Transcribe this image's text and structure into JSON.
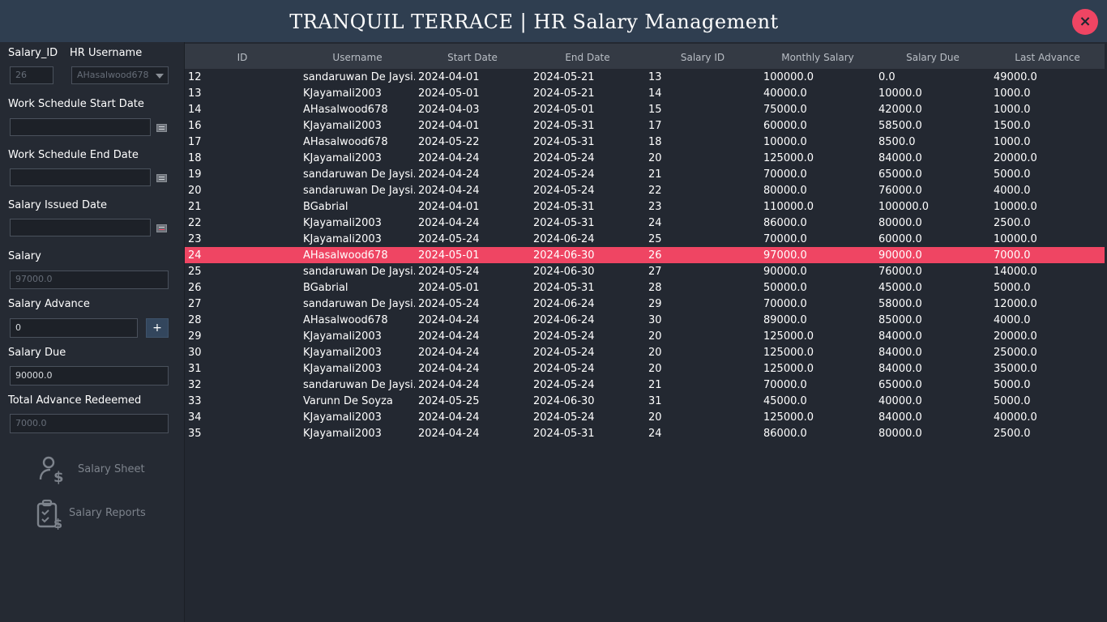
{
  "app": {
    "title": "TRANQUIL TERRACE | HR Salary Management",
    "close_label": "×"
  },
  "form": {
    "salary_id_label": "Salary_ID",
    "salary_id_value": "26",
    "hr_username_label": "HR Username",
    "hr_username_value": "AHasalwood678",
    "work_start_label": "Work Schedule Start Date",
    "work_start_value": "",
    "work_end_label": "Work Schedule End Date",
    "work_end_value": "",
    "issued_date_label": "Salary Issued Date",
    "issued_date_value": "",
    "salary_label": "Salary",
    "salary_value": "97000.0",
    "advance_label": "Salary Advance",
    "advance_value": "0",
    "advance_add_label": "+",
    "due_label": "Salary Due",
    "due_value": "90000.0",
    "redeemed_label": "Total Advance Redeemed",
    "redeemed_value": "7000.0"
  },
  "nav": {
    "salary_sheet_label": "Salary Sheet",
    "salary_reports_label": "Salary Reports"
  },
  "table": {
    "headers": [
      "ID",
      "Username",
      "Start Date",
      "End Date",
      "Salary ID",
      "Monthly Salary",
      "Salary Due",
      "Last Advance"
    ],
    "selected_row_index": 11,
    "rows": [
      [
        "12",
        "sandaruwan De Jaysi...",
        "2024-04-01",
        "2024-05-21",
        "13",
        "100000.0",
        "0.0",
        "49000.0"
      ],
      [
        "13",
        "KJayamali2003",
        "2024-05-01",
        "2024-05-21",
        "14",
        "40000.0",
        "10000.0",
        "1000.0"
      ],
      [
        "14",
        "AHasalwood678",
        "2024-04-03",
        "2024-05-01",
        "15",
        "75000.0",
        "42000.0",
        "1000.0"
      ],
      [
        "16",
        "KJayamali2003",
        "2024-04-01",
        "2024-05-31",
        "17",
        "60000.0",
        "58500.0",
        "1500.0"
      ],
      [
        "17",
        "AHasalwood678",
        "2024-05-22",
        "2024-05-31",
        "18",
        "10000.0",
        "8500.0",
        "1000.0"
      ],
      [
        "18",
        "KJayamali2003",
        "2024-04-24",
        "2024-05-24",
        "20",
        "125000.0",
        "84000.0",
        "20000.0"
      ],
      [
        "19",
        "sandaruwan De Jaysi...",
        "2024-04-24",
        "2024-05-24",
        "21",
        "70000.0",
        "65000.0",
        "5000.0"
      ],
      [
        "20",
        "sandaruwan De Jaysi...",
        "2024-04-24",
        "2024-05-24",
        "22",
        "80000.0",
        "76000.0",
        "4000.0"
      ],
      [
        "21",
        "BGabrial",
        "2024-04-01",
        "2024-05-31",
        "23",
        "110000.0",
        "100000.0",
        "10000.0"
      ],
      [
        "22",
        "KJayamali2003",
        "2024-04-24",
        "2024-05-31",
        "24",
        "86000.0",
        "80000.0",
        "2500.0"
      ],
      [
        "23",
        "KJayamali2003",
        "2024-05-24",
        "2024-06-24",
        "25",
        "70000.0",
        "60000.0",
        "10000.0"
      ],
      [
        "24",
        "AHasalwood678",
        "2024-05-01",
        "2024-06-30",
        "26",
        "97000.0",
        "90000.0",
        "7000.0"
      ],
      [
        "25",
        "sandaruwan De Jaysi...",
        "2024-05-24",
        "2024-06-30",
        "27",
        "90000.0",
        "76000.0",
        "14000.0"
      ],
      [
        "26",
        "BGabrial",
        "2024-05-01",
        "2024-05-31",
        "28",
        "50000.0",
        "45000.0",
        "5000.0"
      ],
      [
        "27",
        "sandaruwan De Jaysi...",
        "2024-05-24",
        "2024-06-24",
        "29",
        "70000.0",
        "58000.0",
        "12000.0"
      ],
      [
        "28",
        "AHasalwood678",
        "2024-04-24",
        "2024-06-24",
        "30",
        "89000.0",
        "85000.0",
        "4000.0"
      ],
      [
        "29",
        "KJayamali2003",
        "2024-04-24",
        "2024-05-24",
        "20",
        "125000.0",
        "84000.0",
        "20000.0"
      ],
      [
        "30",
        "KJayamali2003",
        "2024-04-24",
        "2024-05-24",
        "20",
        "125000.0",
        "84000.0",
        "25000.0"
      ],
      [
        "31",
        "KJayamali2003",
        "2024-04-24",
        "2024-05-24",
        "20",
        "125000.0",
        "84000.0",
        "35000.0"
      ],
      [
        "32",
        "sandaruwan De Jaysi...",
        "2024-04-24",
        "2024-05-24",
        "21",
        "70000.0",
        "65000.0",
        "5000.0"
      ],
      [
        "33",
        "Varunn De Soyza",
        "2024-05-25",
        "2024-06-30",
        "31",
        "45000.0",
        "40000.0",
        "5000.0"
      ],
      [
        "34",
        "KJayamali2003",
        "2024-04-24",
        "2024-05-24",
        "20",
        "125000.0",
        "84000.0",
        "40000.0"
      ],
      [
        "35",
        "KJayamali2003",
        "2024-04-24",
        "2024-05-31",
        "24",
        "86000.0",
        "80000.0",
        "2500.0"
      ]
    ]
  },
  "colors": {
    "title_bar": "#2f3e50",
    "background": "#232831",
    "accent": "#ef4563",
    "header_bg": "#343a44"
  }
}
